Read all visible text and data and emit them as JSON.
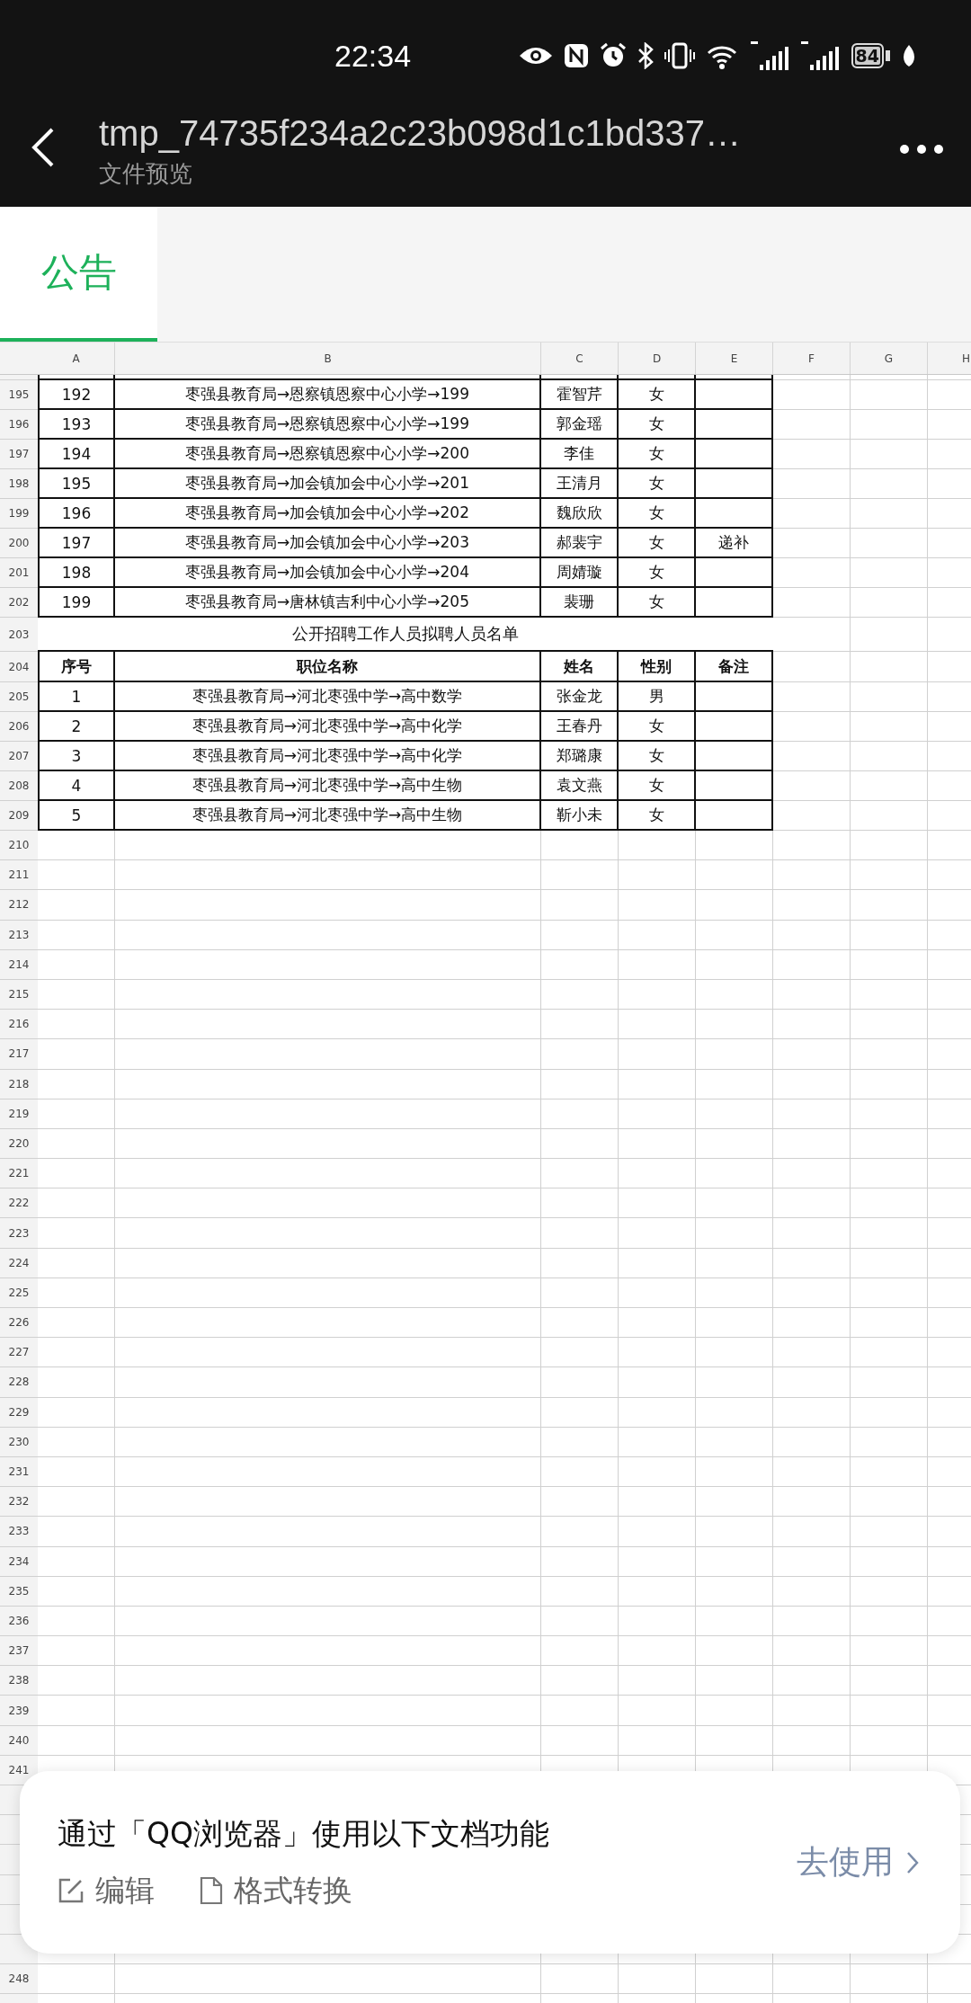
{
  "status_bar": {
    "time": "22:34",
    "battery": "84"
  },
  "header": {
    "title": "tmp_74735f234a2c23b098d1c1bd337…",
    "subtitle": "文件预览"
  },
  "sheet_tabs": [
    {
      "label": "公告",
      "selected": true
    }
  ],
  "sheet": {
    "columns": [
      "A",
      "B",
      "C",
      "D",
      "E",
      "F",
      "G",
      "H"
    ],
    "rows": [
      {
        "number": "195",
        "kind": "record",
        "cells": [
          "192",
          "枣强县教育局→恩察镇恩察中心小学→199",
          "霍智芹",
          "女"
        ]
      },
      {
        "number": "196",
        "kind": "record",
        "cells": [
          "193",
          "枣强县教育局→恩察镇恩察中心小学→199",
          "郭金瑶",
          "女"
        ]
      },
      {
        "number": "197",
        "kind": "record",
        "cells": [
          "194",
          "枣强县教育局→恩察镇恩察中心小学→200",
          "李佳",
          "女"
        ]
      },
      {
        "number": "198",
        "kind": "record",
        "cells": [
          "195",
          "枣强县教育局→加会镇加会中心小学→201",
          "王清月",
          "女"
        ]
      },
      {
        "number": "199",
        "kind": "record",
        "cells": [
          "196",
          "枣强县教育局→加会镇加会中心小学→202",
          "魏欣欣",
          "女"
        ]
      },
      {
        "number": "200",
        "kind": "record",
        "cells": [
          "197",
          "枣强县教育局→加会镇加会中心小学→203",
          "郝裴宇",
          "女",
          "递补"
        ]
      },
      {
        "number": "201",
        "kind": "record",
        "cells": [
          "198",
          "枣强县教育局→加会镇加会中心小学→204",
          "周婧璇",
          "女"
        ]
      },
      {
        "number": "202",
        "kind": "record",
        "cells": [
          "199",
          "枣强县教育局→唐林镇吉利中心小学→205",
          "裴珊",
          "女"
        ]
      },
      {
        "number": "203",
        "kind": "title",
        "text": "公开招聘工作人员拟聘人员名单"
      },
      {
        "number": "204",
        "kind": "header",
        "cells": [
          "序号",
          "职位名称",
          "姓名",
          "性别",
          "备注"
        ]
      },
      {
        "number": "205",
        "kind": "record",
        "cells": [
          "1",
          "枣强县教育局→河北枣强中学→高中数学",
          "张金龙",
          "男"
        ]
      },
      {
        "number": "206",
        "kind": "record",
        "cells": [
          "2",
          "枣强县教育局→河北枣强中学→高中化学",
          "王春丹",
          "女"
        ]
      },
      {
        "number": "207",
        "kind": "record",
        "cells": [
          "3",
          "枣强县教育局→河北枣强中学→高中化学",
          "郑璐康",
          "女"
        ]
      },
      {
        "number": "208",
        "kind": "record",
        "cells": [
          "4",
          "枣强县教育局→河北枣强中学→高中生物",
          "袁文燕",
          "女"
        ]
      },
      {
        "number": "209",
        "kind": "record",
        "cells": [
          "5",
          "枣强县教育局→河北枣强中学→高中生物",
          "靳小未",
          "女"
        ]
      },
      {
        "number": "210",
        "kind": "empty"
      },
      {
        "number": "211",
        "kind": "empty"
      },
      {
        "number": "212",
        "kind": "empty"
      },
      {
        "number": "213",
        "kind": "empty"
      },
      {
        "number": "214",
        "kind": "empty"
      },
      {
        "number": "215",
        "kind": "empty"
      },
      {
        "number": "216",
        "kind": "empty"
      },
      {
        "number": "217",
        "kind": "empty"
      },
      {
        "number": "218",
        "kind": "empty"
      },
      {
        "number": "219",
        "kind": "empty"
      },
      {
        "number": "220",
        "kind": "empty"
      },
      {
        "number": "221",
        "kind": "empty"
      },
      {
        "number": "222",
        "kind": "empty"
      },
      {
        "number": "223",
        "kind": "empty"
      },
      {
        "number": "224",
        "kind": "empty"
      },
      {
        "number": "225",
        "kind": "empty"
      },
      {
        "number": "226",
        "kind": "empty"
      },
      {
        "number": "227",
        "kind": "empty"
      },
      {
        "number": "228",
        "kind": "empty"
      },
      {
        "number": "229",
        "kind": "empty"
      },
      {
        "number": "230",
        "kind": "empty"
      },
      {
        "number": "231",
        "kind": "empty"
      },
      {
        "number": "232",
        "kind": "empty"
      },
      {
        "number": "233",
        "kind": "empty"
      },
      {
        "number": "234",
        "kind": "empty"
      },
      {
        "number": "235",
        "kind": "empty"
      },
      {
        "number": "236",
        "kind": "empty"
      },
      {
        "number": "237",
        "kind": "empty"
      },
      {
        "number": "238",
        "kind": "empty"
      },
      {
        "number": "239",
        "kind": "empty"
      },
      {
        "number": "240",
        "kind": "empty"
      },
      {
        "number": "241",
        "kind": "empty"
      },
      {
        "kind": "empty"
      },
      {
        "kind": "empty"
      },
      {
        "kind": "empty"
      },
      {
        "kind": "empty"
      },
      {
        "kind": "empty"
      },
      {
        "kind": "empty"
      },
      {
        "number": "248",
        "kind": "empty"
      }
    ]
  },
  "popup": {
    "message": "通过「QQ浏览器」使用以下文档功能",
    "features": [
      {
        "kind": "edit",
        "label": "编辑"
      },
      {
        "kind": "convert",
        "label": "格式转换"
      }
    ],
    "action": "去使用"
  }
}
